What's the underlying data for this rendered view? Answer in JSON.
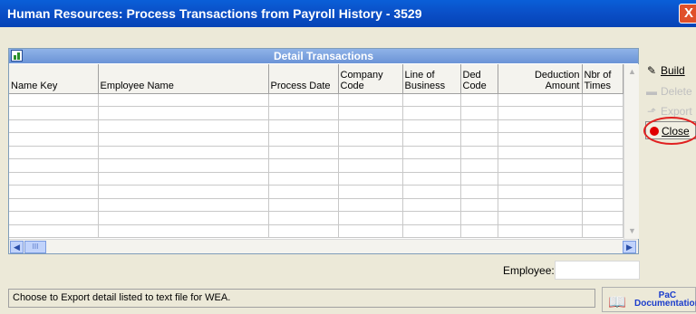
{
  "window": {
    "title": "Human Resources: Process Transactions from Payroll History - 3529",
    "close_glyph": "X"
  },
  "grid": {
    "title": "Detail Transactions",
    "columns": [
      {
        "label": "Name Key",
        "align": "left"
      },
      {
        "label": "Employee Name",
        "align": "left"
      },
      {
        "label": "Process Date",
        "align": "left"
      },
      {
        "label": "Company\nCode",
        "align": "left"
      },
      {
        "label": "Line of\nBusiness",
        "align": "left"
      },
      {
        "label": "Ded\nCode",
        "align": "left"
      },
      {
        "label": "Deduction\nAmount",
        "align": "right"
      },
      {
        "label": "Nbr of\nTimes",
        "align": "left"
      }
    ],
    "empty_rows": 11,
    "hscroll_thumb": "III"
  },
  "side_buttons": {
    "build": "Build",
    "delete": "Delete",
    "export": "Export",
    "close": "Close"
  },
  "employee": {
    "label": "Employee:",
    "value": ""
  },
  "status_text": "Choose to Export detail listed to text file for WEA.",
  "pac_doc": {
    "line1": "PaC",
    "line2": "Documentation"
  },
  "colors": {
    "titlebar": "#0a4ec6",
    "highlight_circle": "#e02020",
    "close_dot": "#e00000"
  }
}
